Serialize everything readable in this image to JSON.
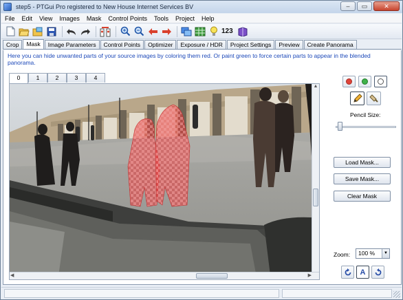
{
  "window": {
    "title": "step5 - PTGui Pro registered to New House Internet Services BV"
  },
  "menu": [
    "File",
    "Edit",
    "View",
    "Images",
    "Mask",
    "Control Points",
    "Tools",
    "Project",
    "Help"
  ],
  "toolbar": {
    "icons": [
      "new-document-icon",
      "open-folder-icon",
      "open-images-icon",
      "save-icon",
      "undo-icon",
      "redo-icon",
      "control-points-icon",
      "zoom-in-icon",
      "zoom-out-icon",
      "arrow-left-icon",
      "arrow-right-icon",
      "panorama-editor-icon",
      "table-icon",
      "lightbulb-icon",
      "numbers-icon",
      "book-icon"
    ],
    "numbers_label": "123"
  },
  "tabs": [
    "Crop",
    "Mask",
    "Image Parameters",
    "Control Points",
    "Optimizer",
    "Exposure / HDR",
    "Project Settings",
    "Preview",
    "Create Panorama"
  ],
  "active_tab": "Mask",
  "info_text": "Here you can hide unwanted parts of your source images by coloring them red. Or paint green to force certain parts to appear in the blended panorama.",
  "image_tabs": [
    "0",
    "1",
    "2",
    "3",
    "4"
  ],
  "active_image_tab": "0",
  "panel": {
    "colors": {
      "red": "#e0443a",
      "green": "#3fb24a",
      "clear": "#ffffff",
      "mask_overlay": "#e8393a"
    },
    "pencil_size_label": "Pencil Size:",
    "load_mask_label": "Load Mask...",
    "save_mask_label": "Save Mask...",
    "clear_mask_label": "Clear Mask",
    "zoom_label": "Zoom:",
    "zoom_value": "100 %",
    "auto_button_label": "A"
  }
}
